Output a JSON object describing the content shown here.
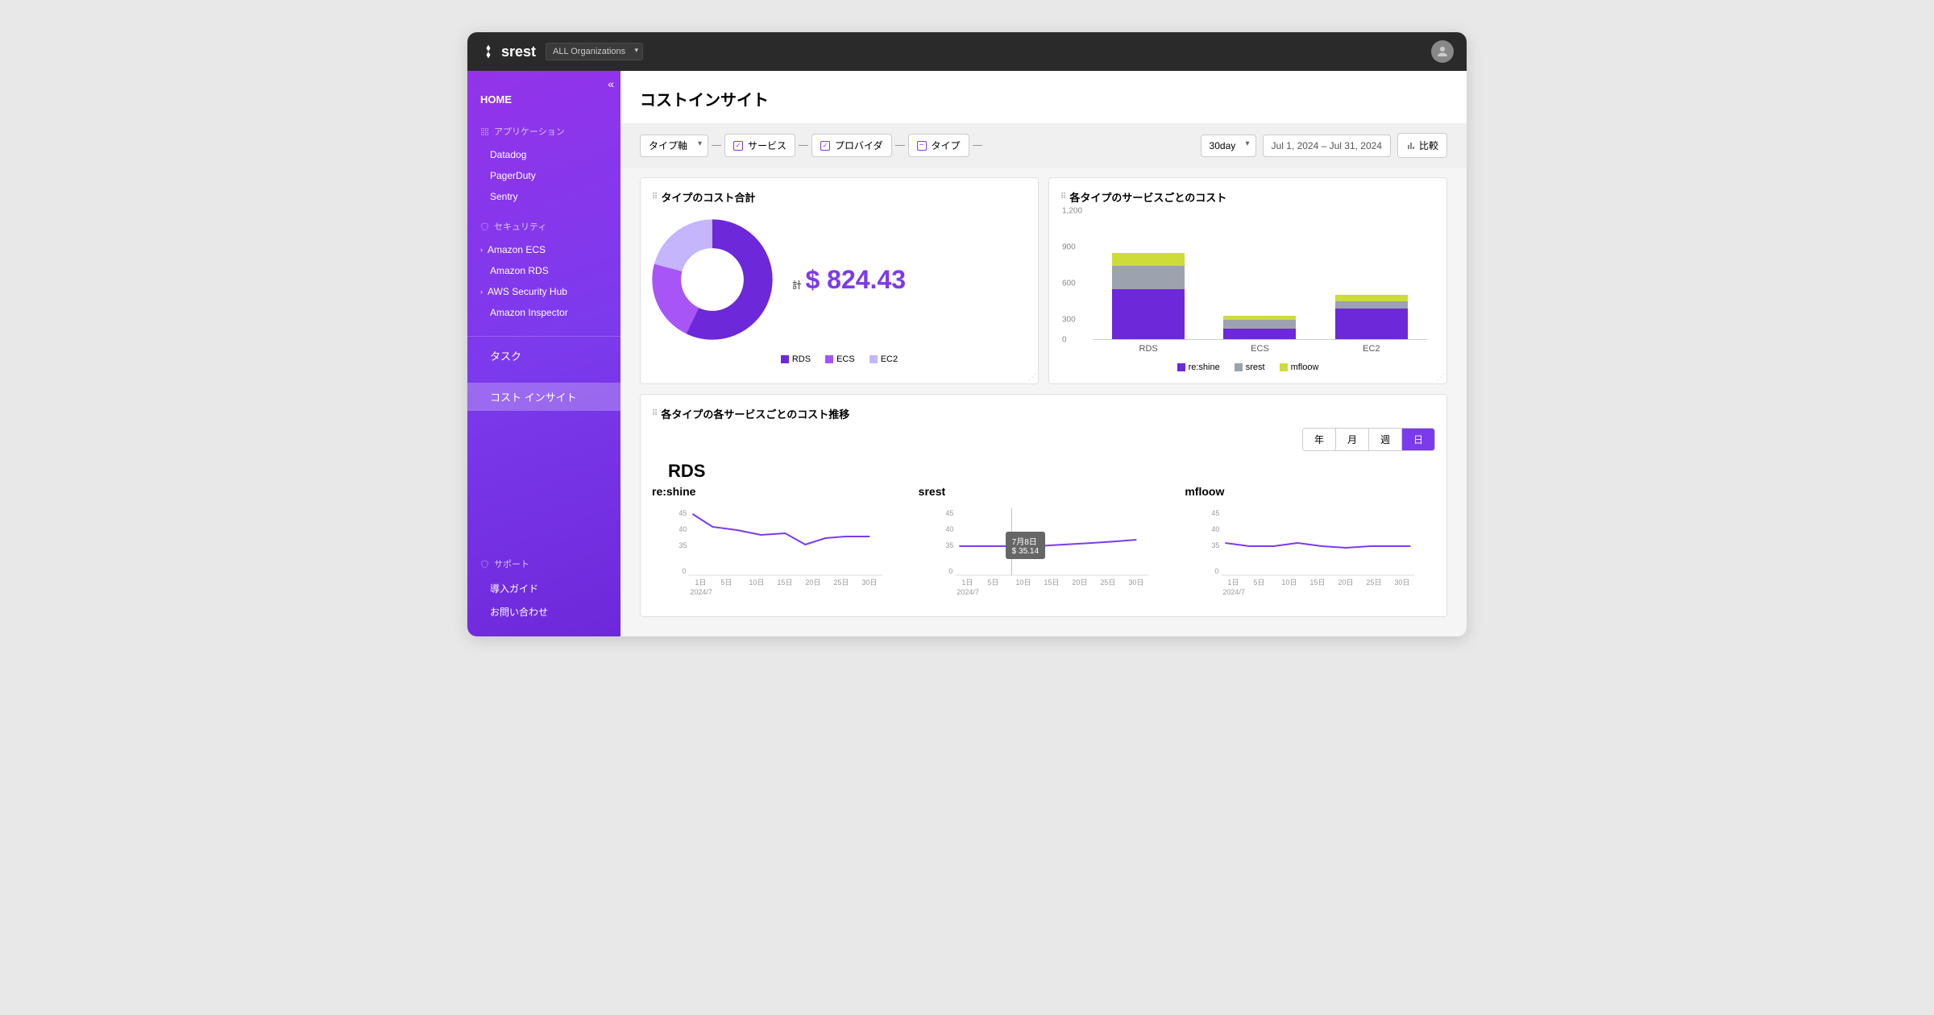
{
  "topbar": {
    "brand": "srest",
    "org_selected": "ALL Organizations"
  },
  "sidebar": {
    "home": "HOME",
    "section_app": "アプリケーション",
    "app_items": [
      "Datadog",
      "PagerDuty",
      "Sentry"
    ],
    "section_sec": "セキュリティ",
    "sec_items": [
      "Amazon ECS",
      "Amazon RDS",
      "AWS Security Hub",
      "Amazon Inspector"
    ],
    "task": "タスク",
    "cost": "コスト インサイト",
    "section_support": "サポート",
    "support_items": [
      "導入ガイド",
      "お問い合わせ"
    ]
  },
  "page": {
    "title": "コストインサイト"
  },
  "filters": {
    "axis": "タイプ軸",
    "chips": [
      "サービス",
      "プロバイダ",
      "タイプ"
    ],
    "period": "30day",
    "range": "Jul 1, 2024  –  Jul 31, 2024",
    "compare": "比較"
  },
  "donut_card": {
    "title": "タイプのコスト合計",
    "total_label": "計",
    "total_value": "$ 824.43",
    "legend": [
      "RDS",
      "ECS",
      "EC2"
    ]
  },
  "bar_card": {
    "title": "各タイプのサービスごとのコスト",
    "legend": [
      "re:shine",
      "srest",
      "mfloow"
    ]
  },
  "trend_card": {
    "title": "各タイプの各サービスごとのコスト推移",
    "tabs": [
      "年",
      "月",
      "週",
      "日"
    ],
    "active_tab": "日",
    "group": "RDS",
    "series": [
      "re:shine",
      "srest",
      "mfloow"
    ],
    "tooltip": {
      "date": "7月8日",
      "value": "$ 35.14"
    },
    "xstart": "2024/7"
  },
  "chart_data": [
    {
      "type": "pie",
      "title": "タイプのコスト合計",
      "categories": [
        "RDS",
        "ECS",
        "EC2"
      ],
      "values": [
        470,
        180,
        175
      ],
      "colors": [
        "#6d28d9",
        "#a855f7",
        "#c4b5fd"
      ],
      "total": 824.43
    },
    {
      "type": "bar",
      "title": "各タイプのサービスごとのコスト",
      "categories": [
        "RDS",
        "ECS",
        "EC2"
      ],
      "series": [
        {
          "name": "re:shine",
          "values": [
            460,
            100,
            280
          ],
          "color": "#6d28d9"
        },
        {
          "name": "srest",
          "values": [
            220,
            80,
            70
          ],
          "color": "#9ca3af"
        },
        {
          "name": "mfloow",
          "values": [
            120,
            40,
            60
          ],
          "color": "#cddc39"
        }
      ],
      "ylim": [
        0,
        1200
      ],
      "yticks": [
        0,
        300,
        600,
        900,
        1200
      ]
    },
    {
      "type": "line",
      "title": "RDS re:shine",
      "x": [
        1,
        5,
        10,
        15,
        20,
        25,
        30
      ],
      "values": [
        43,
        40,
        39,
        38,
        36,
        38,
        38
      ],
      "ylim": [
        0,
        45
      ],
      "yticks": [
        0,
        35,
        40,
        45
      ],
      "xlabel": "2024/7"
    },
    {
      "type": "line",
      "title": "RDS srest",
      "x": [
        1,
        5,
        10,
        15,
        20,
        25,
        30
      ],
      "values": [
        35,
        35,
        35,
        35,
        35,
        36,
        37
      ],
      "ylim": [
        0,
        45
      ],
      "yticks": [
        0,
        35,
        40,
        45
      ],
      "tooltip": {
        "x": "7月8日",
        "y": 35.14
      }
    },
    {
      "type": "line",
      "title": "RDS mfloow",
      "x": [
        1,
        5,
        10,
        15,
        20,
        25,
        30
      ],
      "values": [
        36,
        35,
        35,
        36,
        35,
        35,
        35
      ],
      "ylim": [
        0,
        45
      ],
      "yticks": [
        0,
        35,
        40,
        45
      ]
    }
  ]
}
